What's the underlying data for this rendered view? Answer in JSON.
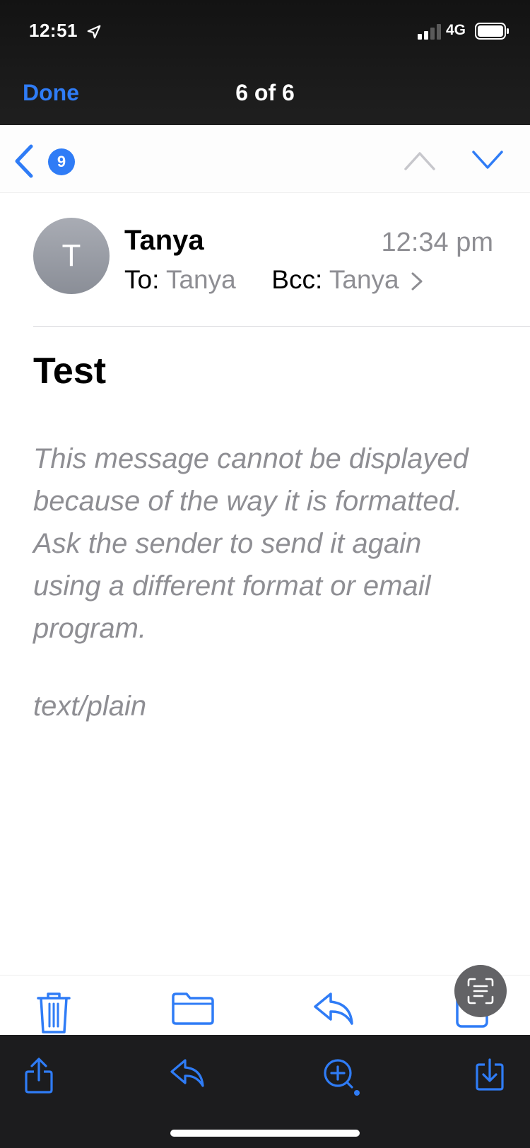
{
  "status_bar": {
    "time": "12:51",
    "network": "4G"
  },
  "viewer": {
    "done_label": "Done",
    "counter": "6 of 6"
  },
  "mail_nav": {
    "unread_badge": "9"
  },
  "message": {
    "avatar_initial": "T",
    "sender": "Tanya",
    "time": "12:34 pm",
    "to_label": "To:",
    "to_value": "Tanya",
    "bcc_label": "Bcc:",
    "bcc_value": "Tanya",
    "subject": "Test",
    "body": "This message cannot be displayed because of the way it is formatted. Ask the sender to send it again using a different format or email program.",
    "mime_type": "text/plain"
  },
  "icons": {
    "mail_toolbar": [
      "trash-icon",
      "folder-icon",
      "reply-icon",
      "compose-icon"
    ],
    "bottom_toolbar": [
      "share-icon",
      "reply-icon",
      "zoom-icon",
      "save-icon"
    ],
    "overlay": "text-scan-icon"
  },
  "colors": {
    "accent": "#2f7cf6",
    "secondary_text": "#8e8e93",
    "dark_bar": "#1c1c1e"
  }
}
